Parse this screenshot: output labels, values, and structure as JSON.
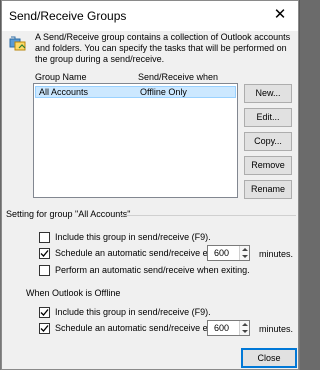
{
  "window": {
    "title": "Send/Receive Groups",
    "description": "A Send/Receive group contains a collection of Outlook accounts and folders. You can specify the tasks that will be performed on the group during a send/receive."
  },
  "list": {
    "columns": [
      "Group Name",
      "Send/Receive when"
    ],
    "rows": [
      {
        "name": "All Accounts",
        "when": "Offline Only",
        "selected": true
      }
    ]
  },
  "buttons": {
    "new": "New...",
    "edit": "Edit...",
    "copy": "Copy...",
    "remove": "Remove",
    "rename": "Rename",
    "close": "Close"
  },
  "settings": {
    "heading": "Setting for group \"All Accounts\"",
    "online_heading": "",
    "online": {
      "include": {
        "label": "Include this group in send/receive (F9).",
        "checked": false
      },
      "schedule": {
        "label": "Schedule an automatic send/receive every",
        "checked": true,
        "value": "600",
        "unit": "minutes."
      },
      "exit": {
        "label": "Perform an automatic send/receive when exiting.",
        "checked": false
      }
    },
    "offline_heading": "When Outlook is Offline",
    "offline": {
      "include": {
        "label": "Include this group in send/receive (F9).",
        "checked": true
      },
      "schedule": {
        "label": "Schedule an automatic send/receive every",
        "checked": true,
        "value": "600",
        "unit": "minutes."
      }
    }
  },
  "colors": {
    "selection": "#cce8ff",
    "selection_border": "#99d1ff",
    "dialog_bg": "#f0f0f0",
    "focus_border": "#0078d7"
  },
  "icons": {
    "app": "send-receive-groups-icon",
    "close": "close-icon",
    "check": "check-mark-icon"
  }
}
